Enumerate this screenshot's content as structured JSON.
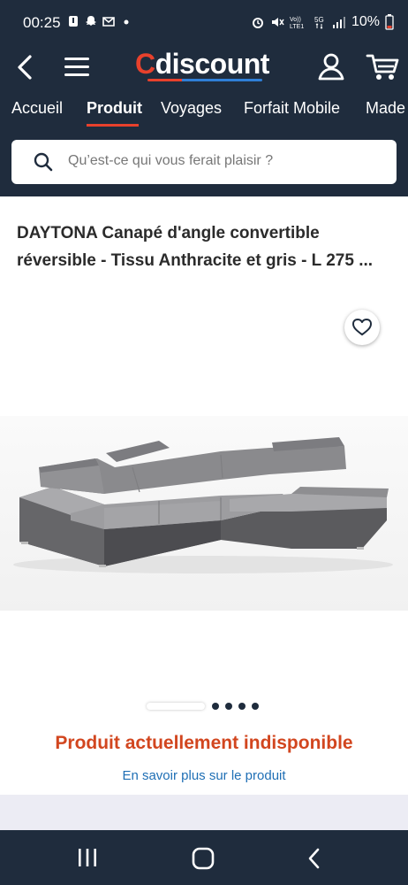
{
  "status_bar": {
    "time": "00:25",
    "battery": "10%"
  },
  "header": {
    "logo": "Cdiscount",
    "nav_tabs": [
      "Accueil",
      "Produit",
      "Voyages",
      "Forfait Mobile",
      "Made"
    ],
    "active_tab": "Produit",
    "search_placeholder": "Qu’est-ce qui vous ferait plaisir ?"
  },
  "product": {
    "title": "DAYTONA Canapé d'angle convertible réversible - Tissu Anthracite et gris - L 275 ...",
    "carousel_pages": 5,
    "carousel_current": 1,
    "availability": "Produit actuellement indisponible",
    "more_link": "En savoir plus sur le produit"
  },
  "colors": {
    "header_bg": "#1f2c3d",
    "accent": "#e8412c",
    "unavailable_text": "#d2461f",
    "link": "#1f6fb5"
  },
  "icons": [
    "back-icon",
    "menu-icon",
    "user-icon",
    "cart-icon",
    "search-icon",
    "heart-icon",
    "recent-apps-icon",
    "home-icon",
    "nav-back-icon"
  ]
}
